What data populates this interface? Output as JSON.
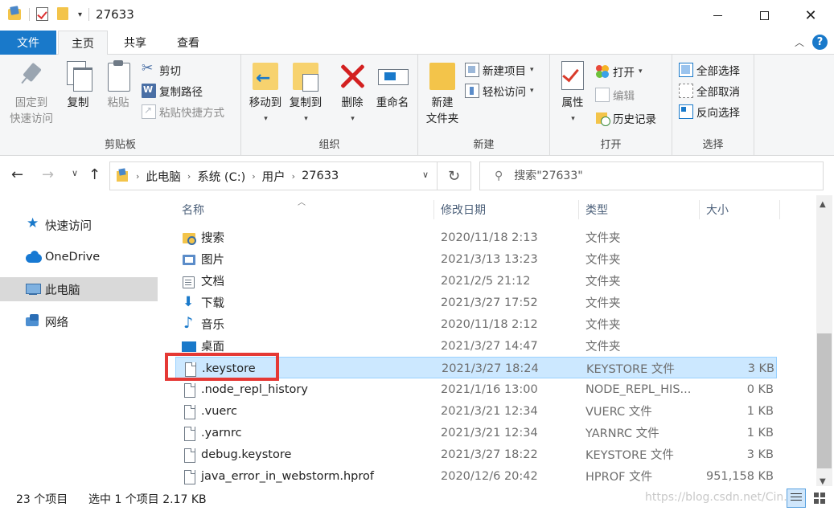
{
  "window": {
    "title": "27633",
    "quick_access_dropdown": "▾"
  },
  "tabs": {
    "file": "文件",
    "home": "主页",
    "share": "共享",
    "view": "查看",
    "help": "?"
  },
  "ribbon": {
    "clipboard": {
      "label": "剪贴板",
      "pin": "固定到\n快速访问",
      "pin_line1": "固定到",
      "pin_line2": "快速访问",
      "copy": "复制",
      "paste": "粘贴",
      "cut": "剪切",
      "copy_path": "复制路径",
      "paste_shortcut": "粘贴快捷方式"
    },
    "organize": {
      "label": "组织",
      "move_to": "移动到",
      "copy_to": "复制到",
      "delete": "删除",
      "rename": "重命名"
    },
    "new": {
      "label": "新建",
      "new_folder_line1": "新建",
      "new_folder_line2": "文件夹",
      "new_item": "新建项目",
      "easy_access": "轻松访问"
    },
    "open": {
      "label": "打开",
      "properties": "属性",
      "open": "打开",
      "edit": "编辑",
      "history": "历史记录"
    },
    "select": {
      "label": "选择",
      "select_all": "全部选择",
      "select_none": "全部取消",
      "invert": "反向选择"
    }
  },
  "address": {
    "crumbs": [
      "此电脑",
      "系统 (C:)",
      "用户",
      "27633"
    ],
    "search_placeholder": "搜索\"27633\""
  },
  "nav_pane": {
    "items": [
      {
        "label": "快速访问",
        "icon": "star-icon"
      },
      {
        "label": "OneDrive",
        "icon": "cloud-icon"
      },
      {
        "label": "此电脑",
        "icon": "computer-icon",
        "selected": true
      },
      {
        "label": "网络",
        "icon": "network-icon"
      }
    ]
  },
  "file_list": {
    "columns": {
      "name": "名称",
      "date": "修改日期",
      "type": "类型",
      "size": "大小"
    },
    "rows": [
      {
        "name": "搜索",
        "date": "2020/11/18 2:13",
        "type": "文件夹",
        "size": "",
        "icon": "search-folder-icon"
      },
      {
        "name": "图片",
        "date": "2021/3/13 13:23",
        "type": "文件夹",
        "size": "",
        "icon": "pictures-folder-icon"
      },
      {
        "name": "文档",
        "date": "2021/2/5 21:12",
        "type": "文件夹",
        "size": "",
        "icon": "documents-folder-icon"
      },
      {
        "name": "下载",
        "date": "2021/3/27 17:52",
        "type": "文件夹",
        "size": "",
        "icon": "downloads-folder-icon"
      },
      {
        "name": "音乐",
        "date": "2020/11/18 2:12",
        "type": "文件夹",
        "size": "",
        "icon": "music-folder-icon"
      },
      {
        "name": "桌面",
        "date": "2021/3/27 14:47",
        "type": "文件夹",
        "size": "",
        "icon": "desktop-folder-icon"
      },
      {
        "name": ".keystore",
        "date": "2021/3/27 18:24",
        "type": "KEYSTORE 文件",
        "size": "3 KB",
        "icon": "file-icon",
        "selected": true
      },
      {
        "name": ".node_repl_history",
        "date": "2021/1/16 13:00",
        "type": "NODE_REPL_HIS...",
        "size": "0 KB",
        "icon": "file-icon"
      },
      {
        "name": ".vuerc",
        "date": "2021/3/21 12:34",
        "type": "VUERC 文件",
        "size": "1 KB",
        "icon": "file-icon"
      },
      {
        "name": ".yarnrc",
        "date": "2021/3/21 12:34",
        "type": "YARNRC 文件",
        "size": "1 KB",
        "icon": "file-icon"
      },
      {
        "name": "debug.keystore",
        "date": "2021/3/27 18:22",
        "type": "KEYSTORE 文件",
        "size": "3 KB",
        "icon": "file-icon"
      },
      {
        "name": "java_error_in_webstorm.hprof",
        "date": "2020/12/6 20:42",
        "type": "HPROF 文件",
        "size": "951,158 KB",
        "icon": "file-icon"
      }
    ]
  },
  "status": {
    "count": "23 个项目",
    "selection": "选中 1 个项目  2.17 KB",
    "watermark": "https://blog.csdn.net/Cin..."
  }
}
